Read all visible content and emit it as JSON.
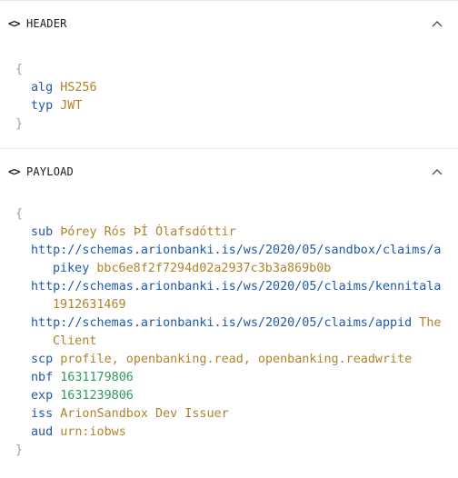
{
  "header_section": {
    "icon": "<>",
    "title": "HEADER",
    "open_brace": "{",
    "close_brace": "}",
    "fields": [
      {
        "key": "alg",
        "value": "HS256"
      },
      {
        "key": "typ",
        "value": "JWT"
      }
    ]
  },
  "payload_section": {
    "icon": "<>",
    "title": "PAYLOAD",
    "open_brace": "{",
    "close_brace": "}",
    "fields": [
      {
        "key": "sub",
        "value": "Þórey Rós ÞÍ Ólafsdóttir"
      },
      {
        "key": "http://schemas.arionbanki.is/ws/2020/05/sandbox/claims/a",
        "key_cont": "pikey",
        "value": "bbc6e8f2f7294d02a2937c3b3a869b0b"
      },
      {
        "key": "http://schemas.arionbanki.is/ws/2020/05/claims/kennitala",
        "value": "1912631469"
      },
      {
        "key": "http://schemas.arionbanki.is/ws/2020/05/claims/appid",
        "value": "The",
        "value_cont": "Client"
      },
      {
        "key": "scp",
        "value": "profile, openbanking.read, openbanking.readwrite"
      },
      {
        "key": "nbf",
        "value": "1631179806"
      },
      {
        "key": "exp",
        "value": "1631239806"
      },
      {
        "key": "iss",
        "value": "ArionSandbox Dev Issuer"
      },
      {
        "key": "aud",
        "value": "urn:iobws"
      }
    ]
  },
  "colors": {
    "key": "#1f59a8",
    "string_value": "#b0832b",
    "number_value": "#2f9a5e",
    "brace": "#9aa3ad"
  },
  "icons": [
    "code-icon",
    "chevron-up-icon"
  ]
}
